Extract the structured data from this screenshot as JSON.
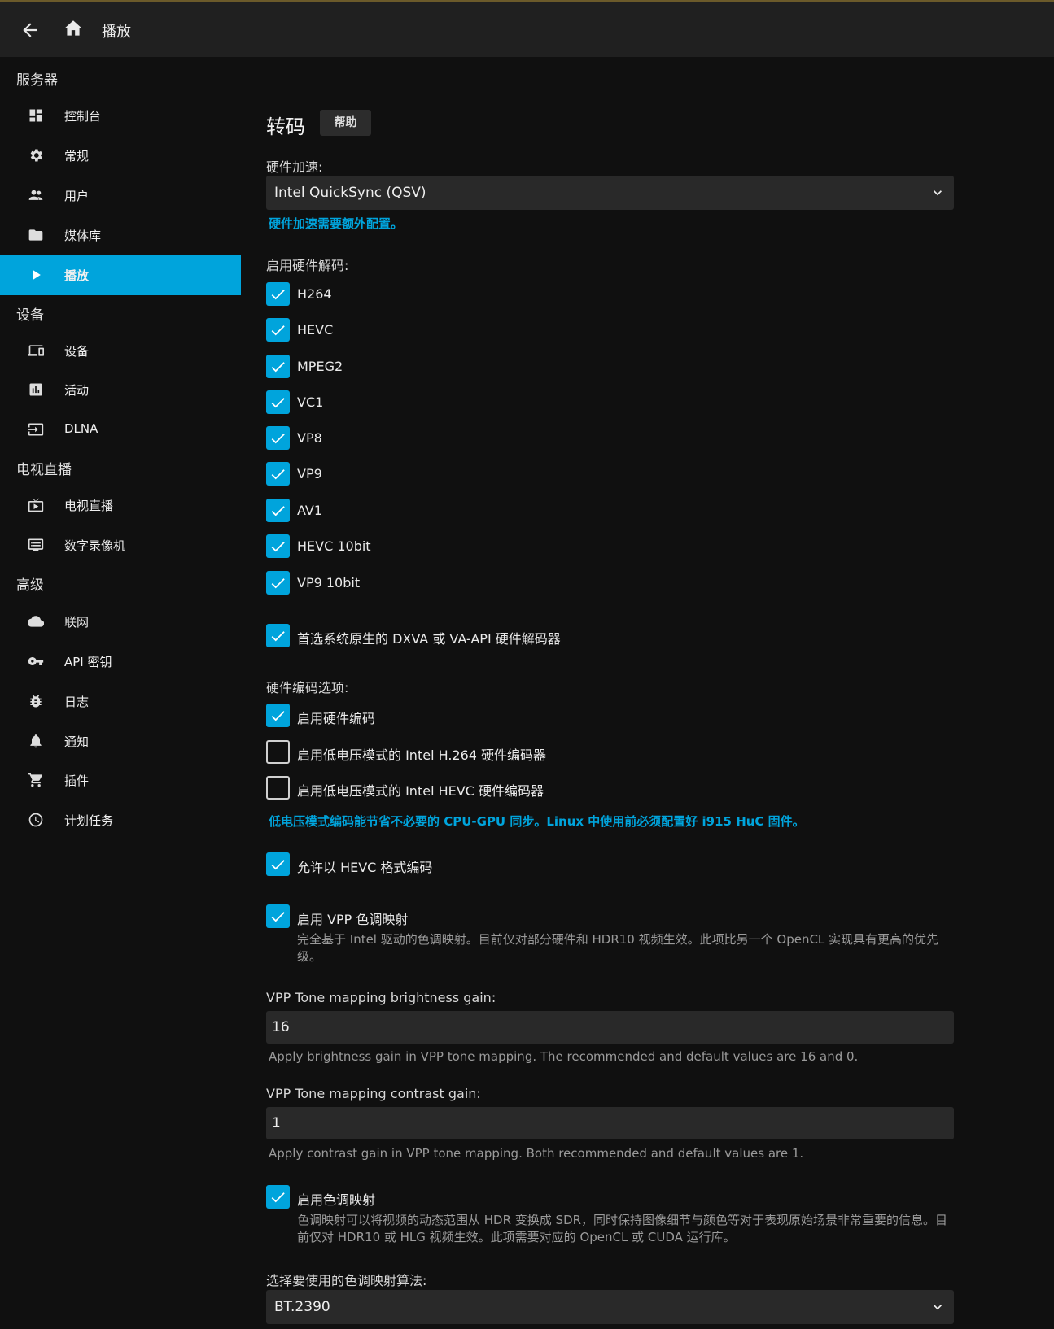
{
  "header": {
    "title": "播放"
  },
  "sidebar": {
    "sections": [
      {
        "title": "服务器",
        "items": [
          "控制台",
          "常规",
          "用户",
          "媒体库",
          "播放"
        ]
      },
      {
        "title": "设备",
        "items": [
          "设备",
          "活动",
          "DLNA"
        ]
      },
      {
        "title": "电视直播",
        "items": [
          "电视直播",
          "数字录像机"
        ]
      },
      {
        "title": "高级",
        "items": [
          "联网",
          "API 密钥",
          "日志",
          "通知",
          "插件",
          "计划任务"
        ]
      }
    ],
    "active_item": "播放"
  },
  "main": {
    "heading": "转码",
    "help_label": "帮助",
    "hw_accel_label": "硬件加速:",
    "hw_accel_value": "Intel QuickSync (QSV)",
    "hw_accel_note": "硬件加速需要额外配置。",
    "decode_label": "启用硬件解码:",
    "decoders": [
      {
        "label": "H264",
        "checked": true
      },
      {
        "label": "HEVC",
        "checked": true
      },
      {
        "label": "MPEG2",
        "checked": true
      },
      {
        "label": "VC1",
        "checked": true
      },
      {
        "label": "VP8",
        "checked": true
      },
      {
        "label": "VP9",
        "checked": true
      },
      {
        "label": "AV1",
        "checked": true
      },
      {
        "label": "HEVC 10bit",
        "checked": true
      },
      {
        "label": "VP9 10bit",
        "checked": true
      }
    ],
    "prefer_native": {
      "label": "首选系统原生的 DXVA 或 VA-API 硬件解码器",
      "checked": true
    },
    "encode_label": "硬件编码选项:",
    "enable_hw_encode": {
      "label": "启用硬件编码",
      "checked": true
    },
    "low_power_h264": {
      "label": "启用低电压模式的 Intel H.264 硬件编码器",
      "checked": false
    },
    "low_power_hevc": {
      "label": "启用低电压模式的 Intel HEVC 硬件编码器",
      "checked": false
    },
    "low_power_note": "低电压模式编码能节省不必要的 CPU-GPU 同步。Linux 中使用前必须配置好 i915 HuC 固件。",
    "allow_hevc": {
      "label": "允许以 HEVC 格式编码",
      "checked": true
    },
    "vpp_tonemap": {
      "label": "启用 VPP 色调映射",
      "checked": true
    },
    "vpp_tonemap_desc": "完全基于 Intel 驱动的色调映射。目前仅对部分硬件和 HDR10 视频生效。此项比另一个 OpenCL 实现具有更高的优先级。",
    "vpp_brightness_label": "VPP Tone mapping brightness gain:",
    "vpp_brightness_value": "16",
    "vpp_brightness_desc": "Apply brightness gain in VPP tone mapping. The recommended and default values are 16 and 0.",
    "vpp_contrast_label": "VPP Tone mapping contrast gain:",
    "vpp_contrast_value": "1",
    "vpp_contrast_desc": "Apply contrast gain in VPP tone mapping. Both recommended and default values are 1.",
    "tonemap": {
      "label": "启用色调映射",
      "checked": true
    },
    "tonemap_desc": "色调映射可以将视频的动态范围从 HDR 变换成 SDR，同时保持图像细节与颜色等对于表现原始场景非常重要的信息。目前仅对 HDR10 或 HLG 视频生效。此项需要对应的 OpenCL 或 CUDA 运行库。",
    "algorithm_label": "选择要使用的色调映射算法:",
    "algorithm_value": "BT.2390"
  },
  "colors": {
    "accent": "#00a4dc",
    "background": "#101010",
    "header": "#202020",
    "field": "#292929"
  }
}
